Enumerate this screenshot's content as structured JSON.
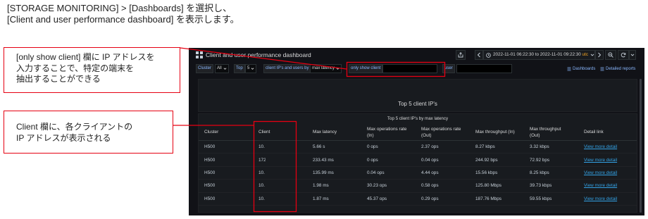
{
  "instructions": {
    "line1": "[STORAGE MONITORING] > [Dashboards] を選択し、",
    "line2": "[Client and user performance dashboard] を表示します。"
  },
  "callouts": {
    "only_show_client": [
      "[only show client] 欄に IP アドレスを",
      "入力することで、特定の端末を",
      "抽出することができる"
    ],
    "client_column": [
      "Client 欄に、各クライアントの",
      "IP アドレスが表示される"
    ]
  },
  "colors": {
    "annotation_red": "#e60012",
    "link": "#33a2e5",
    "timezone": "#f5a623",
    "background": "#111217",
    "panel": "#181b1f"
  },
  "dashboard": {
    "header": {
      "icon": "dashboard-grid-icon",
      "title": "Client and user performance dashboard",
      "time_range": {
        "text": "2022-11-01 06:22:30 to 2022-11-01 09:22:30",
        "timezone": "utc"
      },
      "toolbar_icons": [
        "share-icon",
        "chevron-left-icon",
        "clock-icon",
        "chevron-down-icon",
        "chevron-right-icon",
        "zoom-out-icon",
        "refresh-icon",
        "chevron-down-icon"
      ]
    },
    "variables": {
      "cluster": {
        "label": "Cluster",
        "value": "All"
      },
      "top": {
        "label": "Top",
        "value": "5"
      },
      "order_by": {
        "label": "client IP's and users by",
        "value": "max latency"
      },
      "only_show_client": {
        "label": "only show client"
      },
      "user": {
        "label": "user"
      }
    },
    "links": [
      {
        "label": "Dashboards",
        "icon": "list-icon"
      },
      {
        "label": "Detailed reports",
        "icon": "list-icon"
      }
    ],
    "summary_panel": {
      "title": "Top 5 client IP's"
    },
    "table_panel": {
      "title": "Top 5 client IP's by max latency",
      "columns": [
        "Cluster",
        "Client",
        "Max latency",
        "Max operations rate (In)",
        "Max operations rate (Out)",
        "Max throughput (In)",
        "Max throughput (Out)",
        "Detail link"
      ],
      "rows": [
        [
          "H500",
          "10.",
          "5.66 s",
          "0 ops",
          "2.37 ops",
          "8.27 kbps",
          "3.32 kbps",
          "View more detail"
        ],
        [
          "H500",
          "172",
          "233.43 ms",
          "0 ops",
          "0.04 ops",
          "244.92 bps",
          "72.92 bps",
          "View more detail"
        ],
        [
          "H500",
          "10.",
          "135.99 ms",
          "0.04 ops",
          "4.44 ops",
          "15.56 kbps",
          "8.25 kbps",
          "View more detail"
        ],
        [
          "H500",
          "10.",
          "1.98 ms",
          "30.23 ops",
          "0.58 ops",
          "125.80 Mbps",
          "39.73 kbps",
          "View more detail"
        ],
        [
          "H500",
          "10.",
          "1.87 ms",
          "45.37 ops",
          "0.29 ops",
          "187.76 Mbps",
          "59.55 kbps",
          "View more detail"
        ]
      ]
    }
  }
}
